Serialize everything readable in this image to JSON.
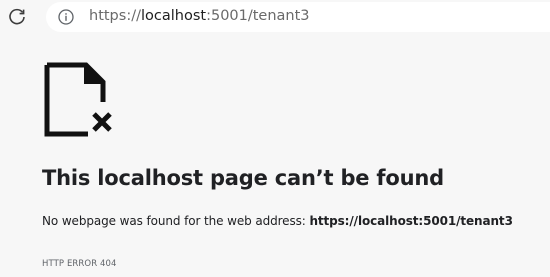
{
  "browser": {
    "reload_icon": "reload-icon",
    "info_icon": "info-icon",
    "url_scheme": "https://",
    "url_host": "localhost",
    "url_rest": ":5001/tenant3"
  },
  "error_page": {
    "icon": "broken-page-icon",
    "heading": "This localhost page can’t be found",
    "message_prefix": "No webpage was found for the web address: ",
    "message_url": "https://localhost:5001/tenant3",
    "error_code": "HTTP ERROR 404"
  }
}
